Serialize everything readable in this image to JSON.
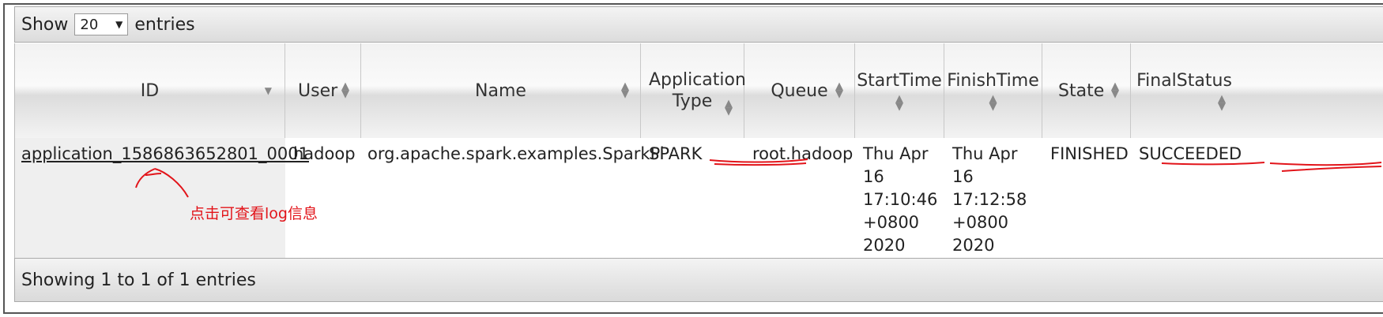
{
  "toolbar": {
    "show_label": "Show",
    "entries_label": "entries",
    "page_size": "20"
  },
  "columns": [
    {
      "label": "ID"
    },
    {
      "label": "User"
    },
    {
      "label": "Name"
    },
    {
      "label": "Application Type"
    },
    {
      "label": "Queue"
    },
    {
      "label": "StartTime"
    },
    {
      "label": "FinishTime"
    },
    {
      "label": "State"
    },
    {
      "label": "FinalStatus"
    }
  ],
  "row": {
    "id": "application_1586863652801_0001",
    "user": "hadoop",
    "name": "org.apache.spark.examples.SparkPi",
    "type": "SPARK",
    "queue": "root.hadoop",
    "start_lines": [
      "Thu Apr",
      "16",
      "17:10:46",
      "+0800",
      "2020"
    ],
    "finish_lines": [
      "Thu Apr",
      "16",
      "17:12:58",
      "+0800",
      "2020"
    ],
    "state": "FINISHED",
    "final_status": "SUCCEEDED"
  },
  "footer": {
    "info": "Showing 1 to 1 of 1 entries"
  },
  "annotation": {
    "text": "点击可查看log信息",
    "color": "#e2141a"
  },
  "icons": {
    "sort": "sort-both-icon",
    "sort_desc": "sort-desc-icon",
    "dropdown": "caret-down-icon"
  }
}
